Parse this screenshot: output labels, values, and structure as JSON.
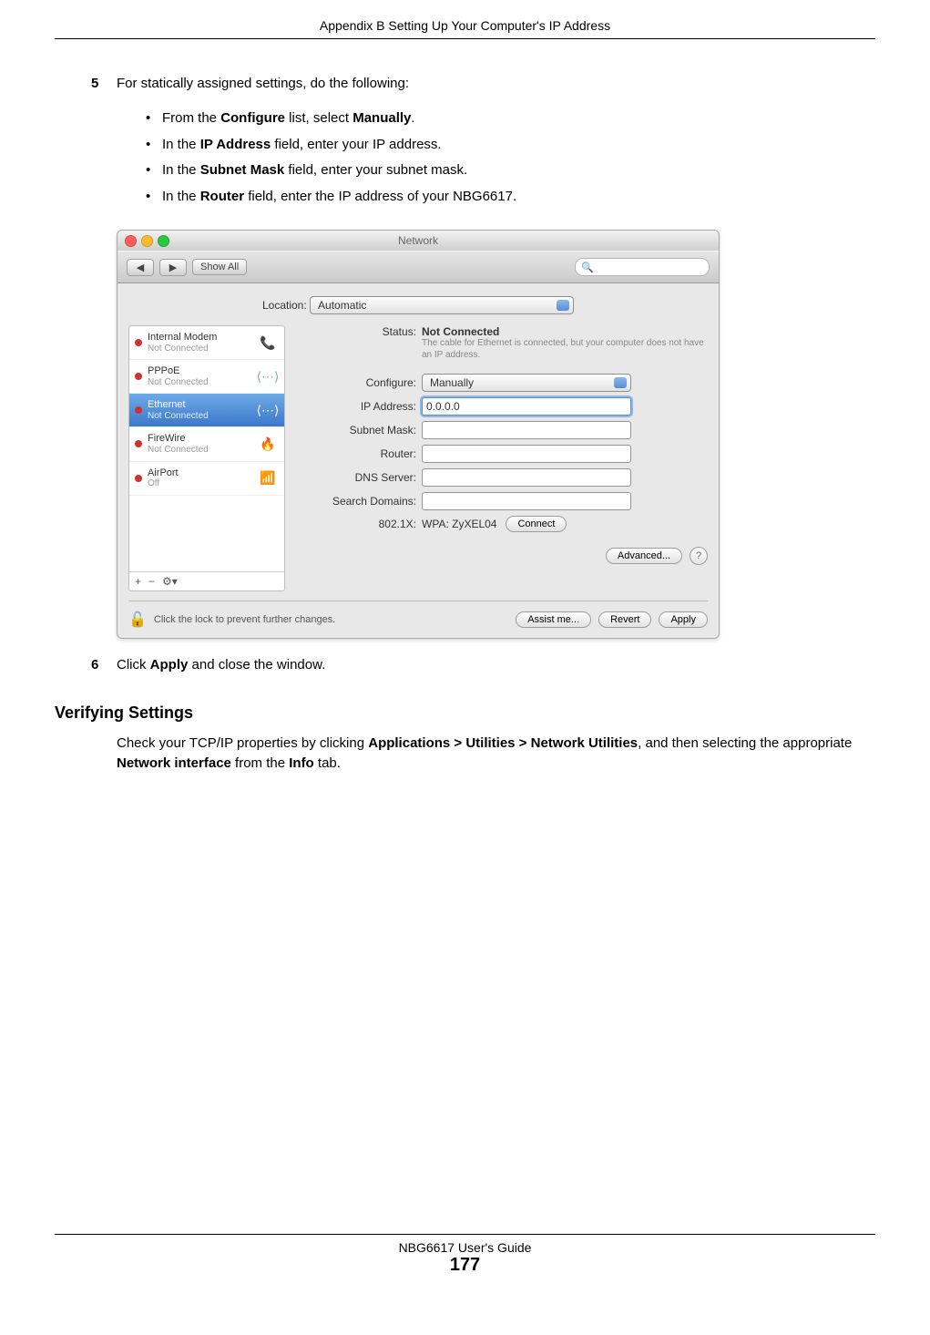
{
  "header": "Appendix B Setting Up Your Computer's IP Address",
  "step5": {
    "num": "5",
    "text": "For statically assigned settings, do the following:"
  },
  "bullets": [
    {
      "pre": "From the ",
      "b": "Configure",
      "mid": " list, select ",
      "b2": "Manually",
      "post": "."
    },
    {
      "pre": "In the ",
      "b": "IP Address",
      "mid": " field, enter your IP address."
    },
    {
      "pre": "In the ",
      "b": "Subnet Mask",
      "mid": " field, enter your subnet mask."
    },
    {
      "pre": "In the ",
      "b": "Router",
      "mid": " field, enter the IP address of your NBG6617."
    }
  ],
  "step6": {
    "num": "6",
    "pre": "Click ",
    "b": "Apply",
    "post": " and close the window."
  },
  "section_h": "Verifying Settings",
  "verify": {
    "pre": "Check your TCP/IP properties by clicking ",
    "b1": "Applications > Utilities > Network Utilities",
    "mid1": ", and then selecting the appropriate ",
    "b2": "Network interface",
    "mid2": " from the ",
    "b3": "Info",
    "post": " tab."
  },
  "footer": {
    "guide": "NBG6617 User's Guide",
    "page": "177"
  },
  "mac": {
    "title": "Network",
    "showall": "Show All",
    "location_label": "Location:",
    "location_value": "Automatic",
    "sidebar": [
      {
        "name": "Internal Modem",
        "sub": "Not Connected",
        "icon": "📞"
      },
      {
        "name": "PPPoE",
        "sub": "Not Connected",
        "icon": "⟨⋯⟩"
      },
      {
        "name": "Ethernet",
        "sub": "Not Connected",
        "icon": "⟨⋯⟩",
        "selected": true
      },
      {
        "name": "FireWire",
        "sub": "Not Connected",
        "icon": "🔥"
      },
      {
        "name": "AirPort",
        "sub": "Off",
        "icon": "📶"
      }
    ],
    "sb_plus": "+",
    "sb_minus": "−",
    "sb_gear": "⚙▾",
    "status_label": "Status:",
    "status_value": "Not Connected",
    "status_desc": "The cable for Ethernet is connected, but your computer does not have an IP address.",
    "configure_label": "Configure:",
    "configure_value": "Manually",
    "ip_label": "IP Address:",
    "ip_value": "0.0.0.0",
    "subnet_label": "Subnet Mask:",
    "router_label": "Router:",
    "dns_label": "DNS Server:",
    "search_label": "Search Domains:",
    "x8021_label": "802.1X:",
    "x8021_value": "WPA: ZyXEL04",
    "connect_btn": "Connect",
    "advanced_btn": "Advanced...",
    "help": "?",
    "lock_text": "Click the lock to prevent further changes.",
    "assist_btn": "Assist me...",
    "revert_btn": "Revert",
    "apply_btn": "Apply"
  }
}
